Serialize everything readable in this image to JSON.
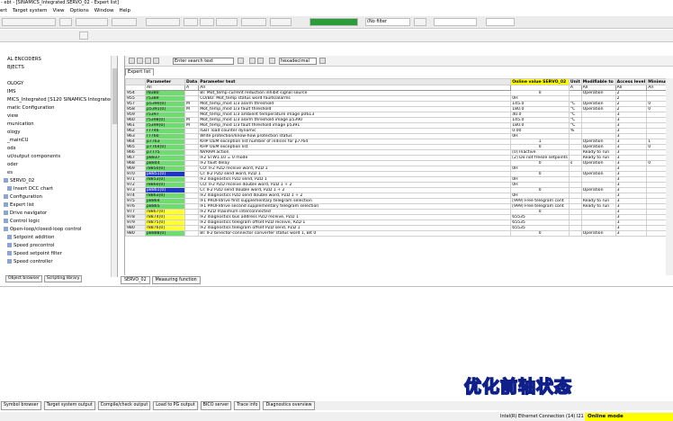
{
  "window": {
    "title": "- ebt - [SINAMICS_Integrated.SERVO_02 - Expert list]"
  },
  "menu": [
    "ert",
    "Target system",
    "View",
    "Options",
    "Window",
    "Help"
  ],
  "toolbar": {
    "filter_select": "(No filter",
    "combo_right": ""
  },
  "tree": {
    "items": [
      {
        "label": "AL ENCODERS",
        "indent": 0
      },
      {
        "label": "BJECTS",
        "indent": 0
      },
      {
        "label": "",
        "indent": 0
      },
      {
        "label": "OLOGY",
        "indent": 0
      },
      {
        "label": "IMS",
        "indent": 0
      },
      {
        "label": "MICS_Integrated [S120 SINAMICS Integrated]",
        "indent": 0
      },
      {
        "label": "matic Configuration",
        "indent": 0
      },
      {
        "label": "view",
        "indent": 0
      },
      {
        "label": "munication",
        "indent": 0
      },
      {
        "label": "ology",
        "indent": 0
      },
      {
        "label": "_mainCU",
        "indent": 0
      },
      {
        "label": "ods",
        "indent": 0
      },
      {
        "label": "ut/output components",
        "indent": 0
      },
      {
        "label": "oder",
        "indent": 0
      },
      {
        "label": "es",
        "indent": 0
      },
      {
        "label": "SERVO_02",
        "indent": 1
      },
      {
        "label": "Insert DCC chart",
        "indent": 2
      },
      {
        "label": "Configuration",
        "indent": 1
      },
      {
        "label": "Expert list",
        "indent": 1
      },
      {
        "label": "Drive navigator",
        "indent": 1
      },
      {
        "label": "Control logic",
        "indent": 1
      },
      {
        "label": "Open-loop/closed-loop control",
        "indent": 1
      },
      {
        "label": "Setpoint addition",
        "indent": 2
      },
      {
        "label": "Speed precontrol",
        "indent": 2
      },
      {
        "label": "Speed setpoint filter",
        "indent": 2
      },
      {
        "label": "Speed controller",
        "indent": 2
      }
    ],
    "tabs": [
      "Object browser",
      "Scripting library"
    ]
  },
  "expert": {
    "search_placeholder": "Enter search text",
    "hex_label": "hexadecimal",
    "subtab": "Expert list",
    "headers": {
      "num": "",
      "parameter": "Parameter",
      "data": "Data",
      "text": "Parameter text",
      "value": "Online value SERVO_02",
      "unit": "Unit",
      "modifiable": "Modifiable to",
      "access": "Access level",
      "min": "Minimum"
    },
    "filters": {
      "num": "",
      "parameter": "All",
      "data": "A",
      "text": "All",
      "unit": "A",
      "modifiable": "All",
      "access": "All",
      "min": "All"
    },
    "rows": [
      {
        "n": "954",
        "p": "r8380",
        "c": "g",
        "d": "",
        "t": "BI: Mot_temp current reduction inhibit signal source",
        "v": "0",
        "u": "",
        "m": "Operation",
        "a": "2",
        "mi": ""
      },
      {
        "n": "955",
        "p": "r5389",
        "c": "g",
        "d": "",
        "t": "CO/BO: Mot_temp status word faults/alarms",
        "v": "0H",
        "u": "",
        "m": "",
        "a": "2",
        "mi": ""
      },
      {
        "n": "957",
        "p": "p5390[0]",
        "c": "g",
        "d": "M",
        "t": "Mot_temp_mod 1/3 alarm threshold",
        "v": "145.0",
        "u": "°C",
        "m": "Operation",
        "a": "2",
        "mi": "0"
      },
      {
        "n": "958",
        "p": "p5391[0]",
        "c": "g",
        "d": "M",
        "t": "Mot_temp_mod 1/3 fault threshold",
        "v": "180.0",
        "u": "°C",
        "m": "Operation",
        "a": "2",
        "mi": "0"
      },
      {
        "n": "959",
        "p": "r5397",
        "c": "g",
        "d": "",
        "t": "Mot_temp_mod 1/3 ambient temperature image p0613",
        "v": "40.0",
        "u": "°C",
        "m": "",
        "a": "3",
        "mi": ""
      },
      {
        "n": "960",
        "p": "r5398[0]",
        "c": "g",
        "d": "M",
        "t": "Mot_temp_mod 1/3 alarm threshold image p5390",
        "v": "145.0",
        "u": "°C",
        "m": "",
        "a": "3",
        "mi": ""
      },
      {
        "n": "961",
        "p": "r5399[0]",
        "c": "g",
        "d": "M",
        "t": "Mot_temp_mod 1/3 fault threshold image p5391",
        "v": "180.0",
        "u": "°C",
        "m": "",
        "a": "3",
        "mi": ""
      },
      {
        "n": "962",
        "p": "r7746",
        "c": "g",
        "d": "",
        "t": "IGBT load counter dynamic",
        "v": "0.00",
        "u": "%",
        "m": "",
        "a": "3",
        "mi": ""
      },
      {
        "n": "963",
        "p": "r7760",
        "c": "g",
        "d": "",
        "t": "Write protection/know-how protection status",
        "v": "0H",
        "u": "",
        "m": "",
        "a": "3",
        "mi": ""
      },
      {
        "n": "964",
        "p": "p7763",
        "c": "g",
        "d": "",
        "t": "KHP OEM exception list number of indices for p7764",
        "v": "1",
        "u": "",
        "m": "Operation",
        "a": "3",
        "mi": "1"
      },
      {
        "n": "965",
        "p": "p7764[0]",
        "c": "g",
        "d": "",
        "t": "KHP OEM exception list",
        "v": "0",
        "u": "",
        "m": "Operation",
        "a": "3",
        "mi": "0"
      },
      {
        "n": "966",
        "p": "p7775",
        "c": "g",
        "d": "",
        "t": "NVRAM action",
        "v": "[0] Inactive",
        "u": "",
        "m": "Ready to run",
        "a": "3",
        "mi": ""
      },
      {
        "n": "967",
        "p": "p8837",
        "c": "g",
        "d": "",
        "t": "IF2 STW1.10 = 0 mode",
        "v": "[2] Do not freeze setpoints",
        "u": "",
        "m": "Ready to run",
        "a": "3",
        "mi": ""
      },
      {
        "n": "968",
        "p": "p8844",
        "c": "g",
        "d": "",
        "t": "IF2 fault delay",
        "v": "0",
        "u": "s",
        "m": "Operation",
        "a": "3",
        "mi": "0"
      },
      {
        "n": "969",
        "p": "r8850[0]",
        "c": "g",
        "d": "",
        "t": "CO: IF2 PZD receive word, PZD 1",
        "v": "0H",
        "u": "",
        "m": "",
        "a": "3",
        "mi": ""
      },
      {
        "n": "970",
        "p": "p8851[0]",
        "c": "b",
        "d": "",
        "t": "CI: IF2 PZD send word, PZD 1",
        "v": "0",
        "u": "",
        "m": "Operation",
        "a": "3",
        "mi": ""
      },
      {
        "n": "971",
        "p": "r8853[0]",
        "c": "g",
        "d": "",
        "t": "IF2 diagnostics PZD send, PZD 1",
        "v": "0H",
        "u": "",
        "m": "",
        "a": "3",
        "mi": ""
      },
      {
        "n": "972",
        "p": "r8860[0]",
        "c": "g",
        "d": "",
        "t": "CO: IF2 PZD receive double word, PZD 1 + 2",
        "v": "0H",
        "u": "",
        "m": "",
        "a": "3",
        "mi": ""
      },
      {
        "n": "973",
        "p": "p8861[0]",
        "c": "b",
        "d": "",
        "t": "CI: IF2 PZD send double word, PZD 1 + 2",
        "v": "0",
        "u": "",
        "m": "Operation",
        "a": "3",
        "mi": ""
      },
      {
        "n": "974",
        "p": "r8863[0]",
        "c": "g",
        "d": "",
        "t": "IF2 diagnostics PZD send double word, PZD 1 + 2",
        "v": "0H",
        "u": "",
        "m": "",
        "a": "3",
        "mi": ""
      },
      {
        "n": "975",
        "p": "p8864",
        "c": "g",
        "d": "",
        "t": "IF1 PROFIdrive first supplementary telegram selection",
        "v": "[999] Free telegram conf.",
        "u": "",
        "m": "Ready to run",
        "a": "3",
        "mi": ""
      },
      {
        "n": "976",
        "p": "p8865",
        "c": "g",
        "d": "",
        "t": "IF1 PROFIdrive second supplementary telegram selection",
        "v": "[999] Free telegram conf.",
        "u": "",
        "m": "Ready to run",
        "a": "3",
        "mi": ""
      },
      {
        "n": "977",
        "p": "r8867[0]",
        "c": "y",
        "d": "",
        "t": "IF2 PZD maximum interconnected",
        "v": "0",
        "u": "",
        "m": "",
        "a": "3",
        "mi": ""
      },
      {
        "n": "978",
        "p": "r8874[0]",
        "c": "y",
        "d": "",
        "t": "IF2 diagnostics bus address PZD receive, PZD 1",
        "v": "65535",
        "u": "",
        "m": "",
        "a": "3",
        "mi": ""
      },
      {
        "n": "979",
        "p": "r8875[0]",
        "c": "y",
        "d": "",
        "t": "IF2 diagnostics telegram offset PZD receive, PZD 1",
        "v": "65535",
        "u": "",
        "m": "",
        "a": "3",
        "mi": ""
      },
      {
        "n": "980",
        "p": "r8876[0]",
        "c": "y",
        "d": "",
        "t": "IF2 diagnostics telegram offset PZD send, PZD 1",
        "v": "65535",
        "u": "",
        "m": "",
        "a": "3",
        "mi": ""
      },
      {
        "n": "980",
        "p": "p8888[0]",
        "c": "g",
        "d": "",
        "t": "BI: IF2 binector-connector converter status word 1, Bit 0",
        "v": "0",
        "u": "",
        "m": "Operation",
        "a": "3",
        "mi": ""
      }
    ]
  },
  "midtabs": [
    "SERVO_02",
    "Measuring function"
  ],
  "overlay_text": "优化前轴状态",
  "taskbar": [
    "Symbol browser",
    "Target system output",
    "Compile/check output",
    "Load to PG output",
    "BICO server",
    "Trace info",
    "Diagnostics overview"
  ],
  "status": {
    "connection": "Intel(R) Ethernet Connection (14) I21",
    "mode": "Online mode"
  },
  "colors": {
    "accent_green": "#6fdc6f",
    "selected_blue": "#1f35c8",
    "highlight_yellow": "#ffff00"
  }
}
